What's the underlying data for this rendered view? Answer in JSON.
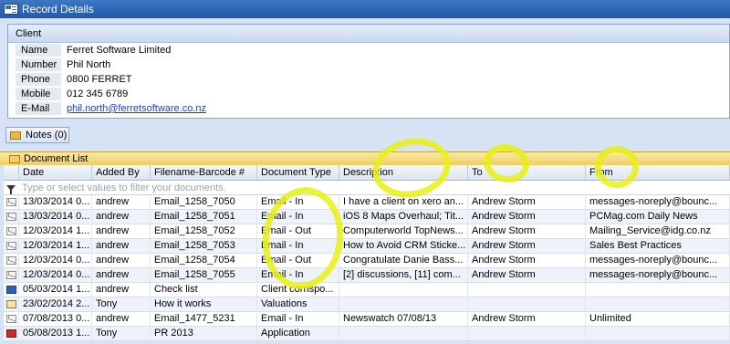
{
  "window": {
    "title": "Record Details"
  },
  "client": {
    "header": "Client",
    "fields": [
      {
        "label": "Name",
        "value": "Ferret Software Limited"
      },
      {
        "label": "Number",
        "value": "Phil North"
      },
      {
        "label": "Phone",
        "value": "0800 FERRET"
      },
      {
        "label": "Mobile",
        "value": "012 345 6789"
      },
      {
        "label": "E-Mail",
        "value": "phil.north@ferretsoftware.co.nz"
      }
    ]
  },
  "notes": {
    "label": "Notes (0)"
  },
  "document_list": {
    "title": "Document List",
    "filter_placeholder": "Type or select values to filter your documents.",
    "columns": [
      "Date",
      "Added By",
      "Filename-Barcode #",
      "Document Type",
      "Description",
      "To",
      "From"
    ],
    "rows": [
      {
        "icon": "email-icon",
        "date": "13/03/2014 0...",
        "added_by": "andrew",
        "filename": "Email_1258_7050",
        "type": "Email - In",
        "description": "I have a client on xero an...",
        "to": "Andrew Storm",
        "from": "messages-noreply@bounc..."
      },
      {
        "icon": "email-icon",
        "date": "13/03/2014 0...",
        "added_by": "andrew",
        "filename": "Email_1258_7051",
        "type": "Email - In",
        "description": "iOS 8 Maps Overhaul; Tit...",
        "to": "Andrew Storm",
        "from": "PCMag.com Daily News"
      },
      {
        "icon": "email-icon",
        "date": "12/03/2014 1...",
        "added_by": "andrew",
        "filename": "Email_1258_7052",
        "type": "Email - Out",
        "description": "Computerworld TopNews...",
        "to": "Andrew Storm",
        "from": "Mailing_Service@idg.co.nz"
      },
      {
        "icon": "email-icon",
        "date": "12/03/2014 1...",
        "added_by": "andrew",
        "filename": "Email_1258_7053",
        "type": "Email - In",
        "description": "How to Avoid CRM Sticke...",
        "to": "Andrew Storm",
        "from": "Sales Best Practices"
      },
      {
        "icon": "email-icon",
        "date": "12/03/2014 0...",
        "added_by": "andrew",
        "filename": "Email_1258_7054",
        "type": "Email - Out",
        "description": "Congratulate Danie Bass...",
        "to": "Andrew Storm",
        "from": "messages-noreply@bounc..."
      },
      {
        "icon": "email-icon",
        "date": "12/03/2014 0...",
        "added_by": "andrew",
        "filename": "Email_1258_7055",
        "type": "Email - In",
        "description": "[2] discussions, [11] com...",
        "to": "Andrew Storm",
        "from": "messages-noreply@bounc..."
      },
      {
        "icon": "word-doc-icon",
        "date": "05/03/2014 1...",
        "added_by": "andrew",
        "filename": "Check list",
        "type": "Client corrispo...",
        "description": "",
        "to": "",
        "from": ""
      },
      {
        "icon": "note-icon",
        "date": "23/02/2014 2...",
        "added_by": "Tony",
        "filename": "How it works",
        "type": "Valuations",
        "description": "",
        "to": "",
        "from": ""
      },
      {
        "icon": "email-icon",
        "date": "07/08/2013 0...",
        "added_by": "andrew",
        "filename": "Email_1477_5231",
        "type": "Email - In",
        "description": "Newswatch 07/08/13",
        "to": "Andrew Storm",
        "from": "Unlimited"
      },
      {
        "icon": "pdf-icon",
        "date": "05/08/2013 1...",
        "added_by": "Tony",
        "filename": "PR 2013",
        "type": "Application",
        "description": "",
        "to": "",
        "from": ""
      }
    ]
  },
  "colors": {
    "titlebar": "#2f66b6",
    "list_header": "#efcd63",
    "highlighter": "#e8f014"
  }
}
